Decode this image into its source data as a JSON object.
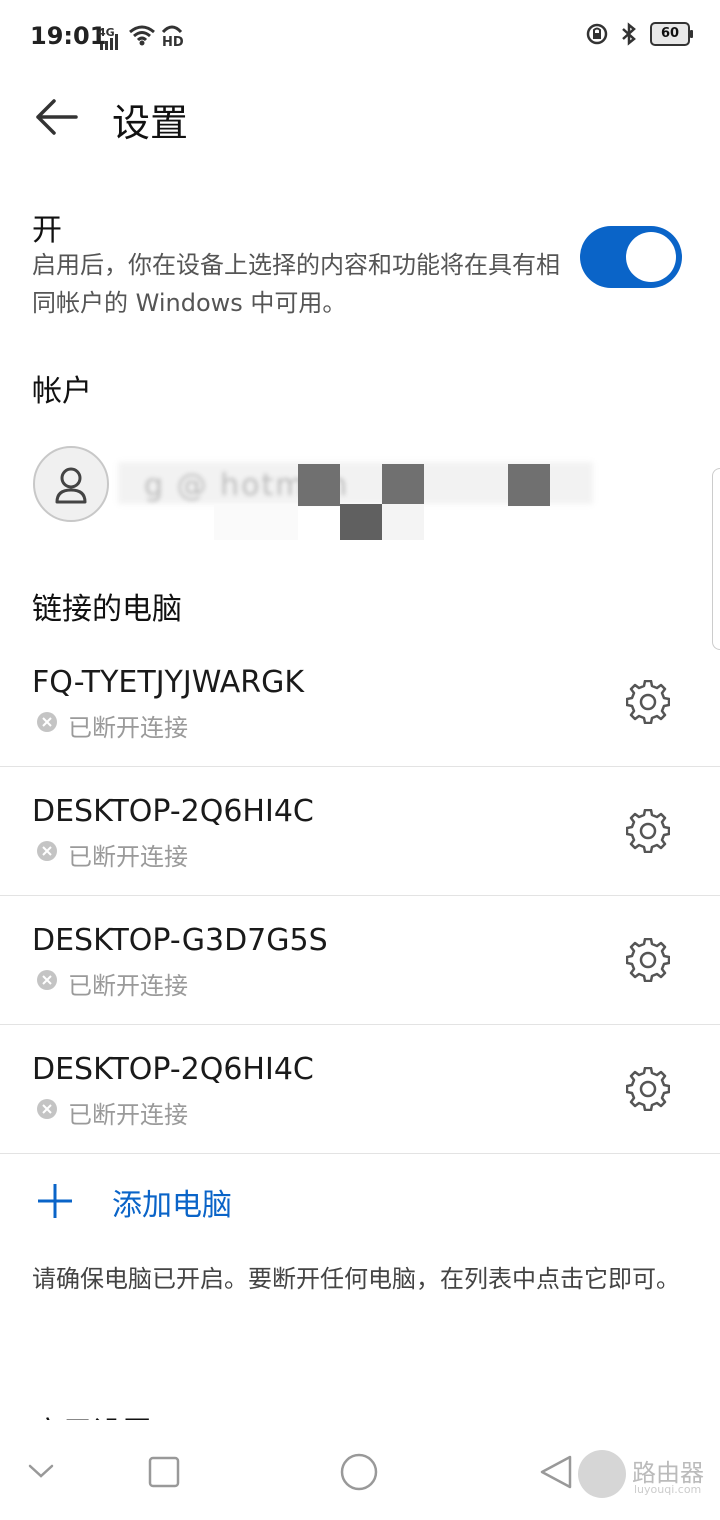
{
  "status_bar": {
    "time": "19:01",
    "network": "4G",
    "battery": "60"
  },
  "header": {
    "title": "设置"
  },
  "sync": {
    "title": "开",
    "description": "启用后，你在设备上选择的内容和功能将在具有相同帐户的 Windows 中可用。",
    "enabled": true
  },
  "account": {
    "heading": "帐户",
    "email_obscured": "g          @ hotm  m"
  },
  "linked_pcs": {
    "heading": "链接的电脑",
    "devices": [
      {
        "name": "FQ-TYETJYJWARGK",
        "status": "已断开连接"
      },
      {
        "name": "DESKTOP-2Q6HI4C",
        "status": "已断开连接"
      },
      {
        "name": "DESKTOP-G3D7G5S",
        "status": "已断开连接"
      },
      {
        "name": "DESKTOP-2Q6HI4C",
        "status": "已断开连接"
      }
    ]
  },
  "add_pc": {
    "label": "添加电脑"
  },
  "hint": "请确保电脑已开启。要断开任何电脑，在列表中点击它即可。",
  "app_settings_heading": "应用设置",
  "watermark": {
    "text": "路由器",
    "sub": "luyouqi.com"
  },
  "colors": {
    "accent": "#0a64c8",
    "muted": "#9a9a9a"
  }
}
